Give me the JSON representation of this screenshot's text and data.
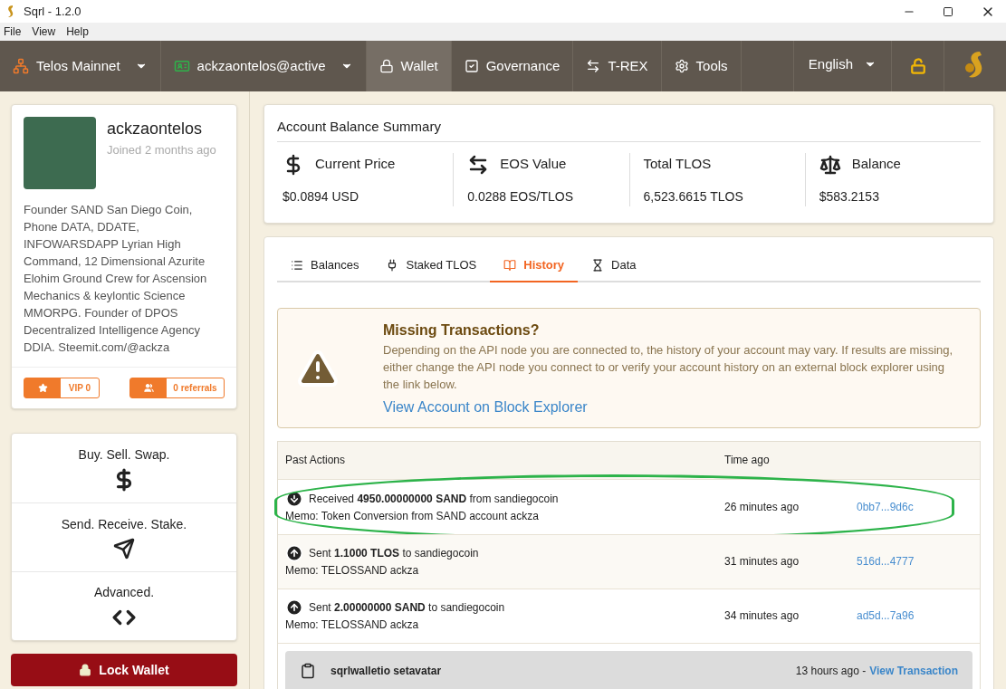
{
  "window": {
    "title": "Sqrl - 1.2.0"
  },
  "menu": [
    "File",
    "View",
    "Help"
  ],
  "nav": {
    "items": [
      {
        "label": "Telos Mainnet",
        "selected": false,
        "dropdown": true
      },
      {
        "label": "ackzaontelos@active",
        "selected": false,
        "dropdown": true
      },
      {
        "label": "Wallet",
        "selected": true,
        "dropdown": false
      },
      {
        "label": "Governance",
        "selected": false,
        "dropdown": false
      },
      {
        "label": "T-REX",
        "selected": false,
        "dropdown": false
      },
      {
        "label": "Tools",
        "selected": false,
        "dropdown": false
      }
    ],
    "language": "English"
  },
  "profile": {
    "name": "ackzaontelos",
    "joined": "Joined 2 months ago",
    "bio": "Founder SAND San Diego Coin, Phone DATA, DDATE, INFOWARSDAPP Lyrian High Command, 12 Dimensional Azurite Elohim Ground Crew for Ascension Mechanics & keylontic Science MMORPG. Founder of DPOS Decentralized Intelligence Agency DDIA. Steemit.com/@ackza",
    "vip": "VIP 0",
    "referrals": "0 referrals"
  },
  "actions": [
    "Buy. Sell. Swap.",
    "Send. Receive. Stake.",
    "Advanced."
  ],
  "lock_button": "Lock Wallet",
  "summary": {
    "title": "Account Balance Summary",
    "stats": [
      {
        "label": "Current Price",
        "value": "$0.0894 USD"
      },
      {
        "label": "EOS Value",
        "value": "0.0288 EOS/TLOS"
      },
      {
        "label": "Total TLOS",
        "value": "6,523.6615 TLOS"
      },
      {
        "label": "Balance",
        "value": "$583.2153"
      }
    ]
  },
  "tabs": [
    {
      "label": "Balances",
      "selected": false
    },
    {
      "label": "Staked TLOS",
      "selected": false
    },
    {
      "label": "History",
      "selected": true
    },
    {
      "label": "Data",
      "selected": false
    }
  ],
  "notice": {
    "title": "Missing Transactions?",
    "text": "Depending on the API node you are connected to, the history of your account may vary. If results are missing, either change the API node you connect to or verify your account history on an external block explorer using the link below.",
    "link": "View Account on Block Explorer"
  },
  "history": {
    "columns": [
      "Past Actions",
      "Time ago"
    ],
    "rows": [
      {
        "kind": "received",
        "action": "Received **4950.00000000 SAND** from sandiegocoin",
        "memo": "Memo: Token Conversion from SAND account ackza",
        "time": "26 minutes ago",
        "tx": "0bb7...9d6c",
        "highlighted": true
      },
      {
        "kind": "sent",
        "action": "Sent **1.1000 TLOS** to sandiegocoin",
        "memo": "Memo: TELOSSAND ackza",
        "time": "31 minutes ago",
        "tx": "516d...4777",
        "highlighted": false
      },
      {
        "kind": "sent",
        "action": "Sent **2.00000000 SAND** to sandiegocoin",
        "memo": "Memo: TELOSSAND ackza",
        "time": "34 minutes ago",
        "tx": "ad5d...7a96",
        "highlighted": false
      }
    ],
    "other": {
      "action": "sqrlwalletio setavatar",
      "time": "13 hours ago -",
      "link": "View Transaction"
    }
  }
}
